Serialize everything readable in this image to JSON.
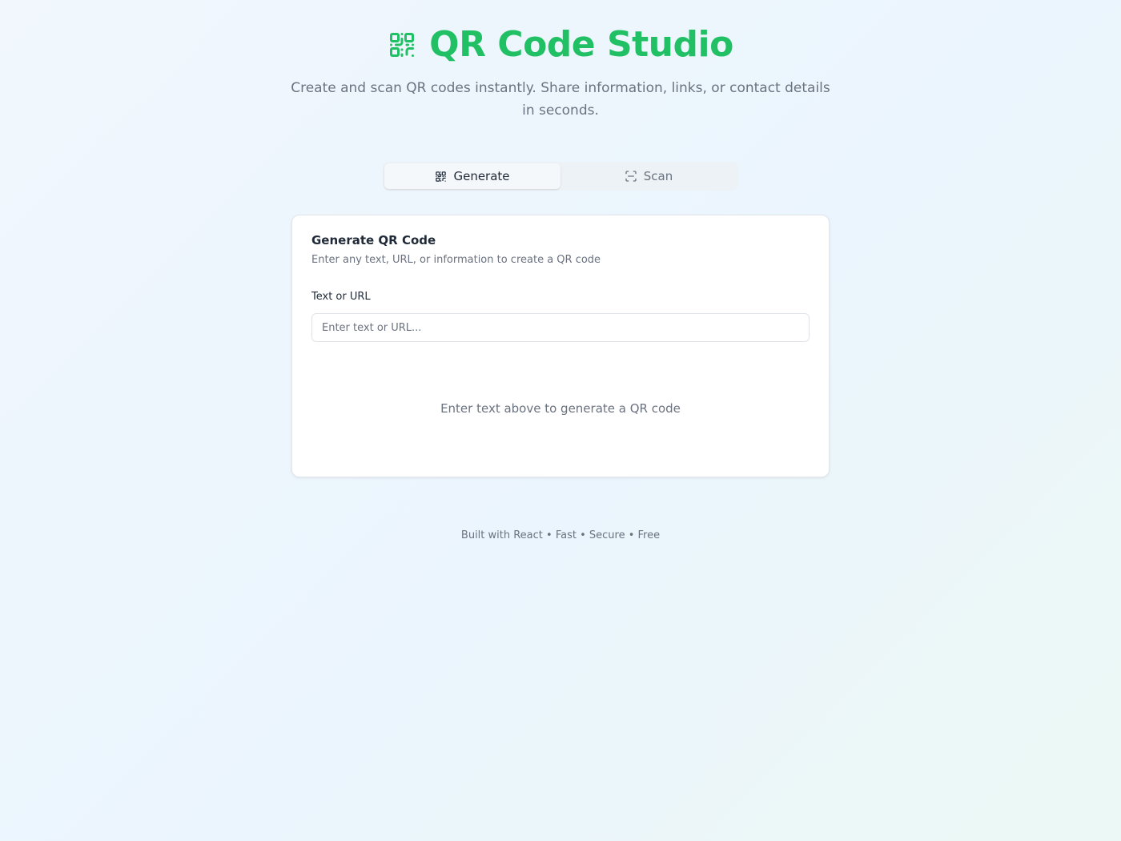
{
  "header": {
    "title": "QR Code Studio",
    "subtitle": "Create and scan QR codes instantly. Share information, links, or contact details in seconds.",
    "logo_icon": "qr-code-icon",
    "brand_color": "#22c064"
  },
  "tabs": [
    {
      "label": "Generate",
      "icon": "qr-code-icon",
      "active": true
    },
    {
      "label": "Scan",
      "icon": "scan-icon",
      "active": false
    }
  ],
  "card": {
    "title": "Generate QR Code",
    "description": "Enter any text, URL, or information to create a QR code",
    "field_label": "Text or URL",
    "input_value": "",
    "input_placeholder": "Enter text or URL...",
    "empty_state": "Enter text above to generate a QR code"
  },
  "footer": {
    "text": "Built with React • Fast • Secure • Free"
  }
}
